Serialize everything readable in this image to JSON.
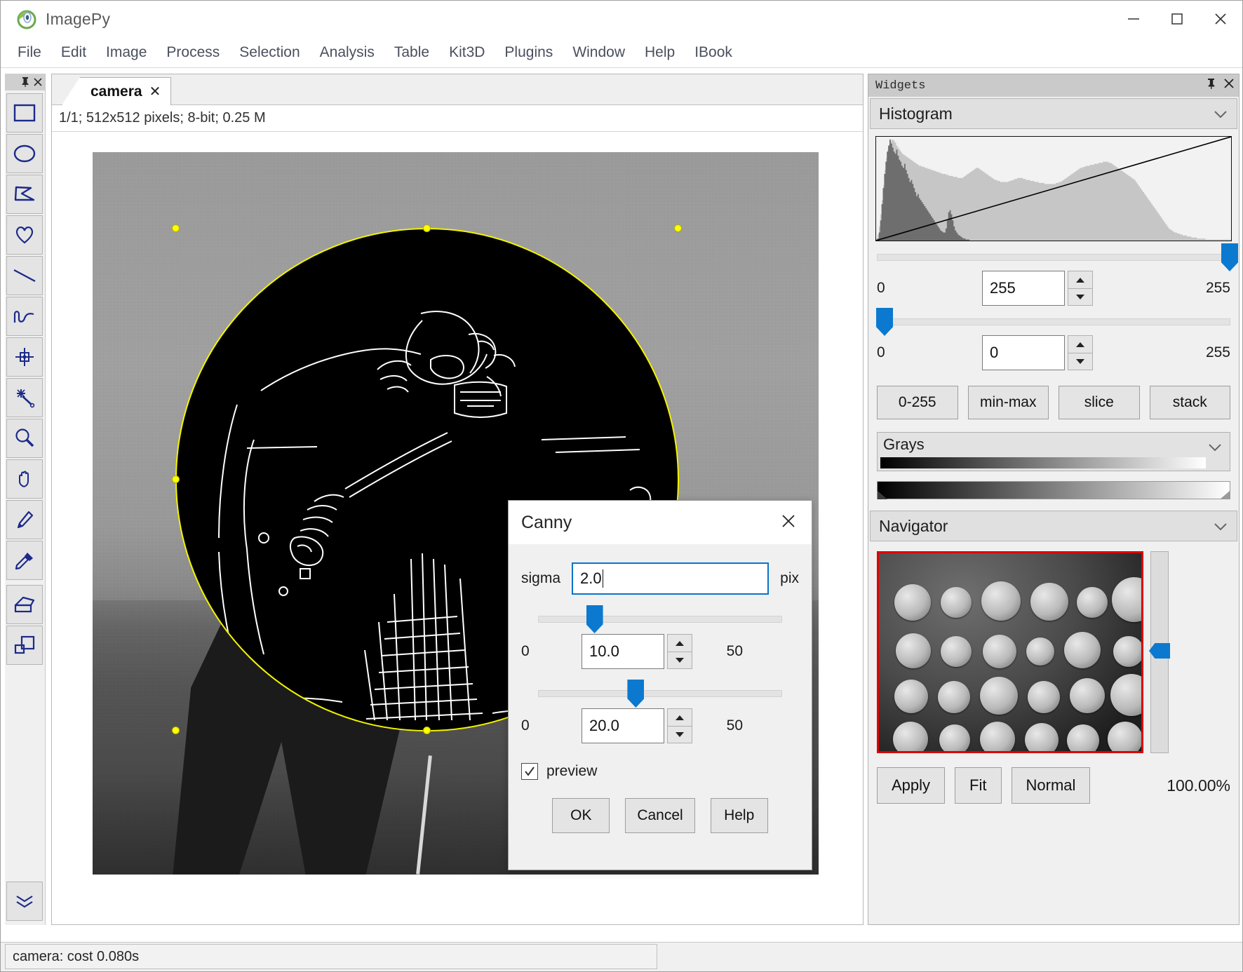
{
  "window": {
    "app_title": "ImagePy",
    "logo_icon": "imagepy-logo-icon",
    "minimize_icon": "minimize-icon",
    "maximize_icon": "maximize-icon",
    "close_icon": "close-icon"
  },
  "menubar": {
    "items": [
      {
        "label": "File"
      },
      {
        "label": "Edit"
      },
      {
        "label": "Image"
      },
      {
        "label": "Process"
      },
      {
        "label": "Selection"
      },
      {
        "label": "Analysis"
      },
      {
        "label": "Table"
      },
      {
        "label": "Kit3D"
      },
      {
        "label": "Plugins"
      },
      {
        "label": "Window"
      },
      {
        "label": "Help"
      },
      {
        "label": "IBook"
      }
    ]
  },
  "toolbar": {
    "pin_icon": "pin-icon",
    "close_icon": "close-icon",
    "tools": [
      {
        "name": "rectangle-tool",
        "icon": "rectangle-icon"
      },
      {
        "name": "ellipse-tool",
        "icon": "ellipse-icon"
      },
      {
        "name": "polygon-tool",
        "icon": "polygon-icon"
      },
      {
        "name": "freehand-tool",
        "icon": "heart-freehand-icon"
      },
      {
        "name": "line-tool",
        "icon": "line-icon"
      },
      {
        "name": "curve-tool",
        "icon": "wave-curve-icon"
      },
      {
        "name": "point-tool",
        "icon": "crosshair-point-icon"
      },
      {
        "name": "magic-wand-tool",
        "icon": "magic-wand-icon"
      },
      {
        "name": "zoom-tool",
        "icon": "magnifier-icon"
      },
      {
        "name": "pan-tool",
        "icon": "hand-icon"
      },
      {
        "name": "pencil-tool",
        "icon": "pencil-icon"
      },
      {
        "name": "dropper-tool",
        "icon": "eyedropper-icon"
      },
      {
        "name": "fill-tool",
        "icon": "paint-bucket-icon"
      },
      {
        "name": "shapes-tool",
        "icon": "overlap-shapes-icon"
      }
    ],
    "bottom_tool": {
      "name": "more-tools",
      "icon": "double-chevron-down-icon"
    }
  },
  "canvas": {
    "tab": {
      "label": "camera",
      "close_icon": "close-icon"
    },
    "info": "1/1;   512x512 pixels; 8-bit; 0.25 M"
  },
  "dialog": {
    "title": "Canny",
    "close_icon": "close-icon",
    "sigma": {
      "label": "sigma",
      "value": "2.0",
      "unit": "pix"
    },
    "low_threshold": {
      "min": "0",
      "value": "10.0",
      "max": "50",
      "slider_percent": 23
    },
    "high_threshold": {
      "min": "0",
      "value": "20.0",
      "max": "50",
      "slider_percent": 40
    },
    "preview": {
      "label": "preview",
      "checked": true,
      "check_icon": "check-icon"
    },
    "buttons": {
      "ok": "OK",
      "cancel": "Cancel",
      "help": "Help"
    }
  },
  "widgets": {
    "panel_title": "Widgets",
    "pin_icon": "pin-icon",
    "close_icon": "close-icon",
    "histogram": {
      "title": "Histogram",
      "chevron_icon": "chevron-down-icon",
      "high": {
        "min": "0",
        "value": "255",
        "max": "255",
        "slider_percent": 100
      },
      "low": {
        "min": "0",
        "value": "0",
        "max": "255",
        "slider_percent": 2
      },
      "buttons": [
        {
          "label": "0-255",
          "name": "range-0-255-button"
        },
        {
          "label": "min-max",
          "name": "range-min-max-button"
        },
        {
          "label": "slice",
          "name": "slice-button"
        },
        {
          "label": "stack",
          "name": "stack-button"
        }
      ],
      "lut": {
        "name": "Grays",
        "chevron_icon": "chevron-down-icon"
      }
    },
    "navigator": {
      "title": "Navigator",
      "chevron_icon": "chevron-down-icon",
      "buttons": {
        "apply": "Apply",
        "fit": "Fit",
        "normal": "Normal"
      },
      "zoom_level": "100.00%"
    }
  },
  "statusbar": {
    "message": "camera: cost 0.080s"
  },
  "colors": {
    "accent_blue": "#0b79cf",
    "tool_blue": "#1c2a8a",
    "roi_yellow": "#f4f400",
    "nav_border_red": "#dd0000"
  },
  "chart_data": {
    "type": "bar",
    "title": "Histogram",
    "xlabel": "",
    "ylabel": "",
    "xlim": [
      0,
      255
    ],
    "ylim": [
      0,
      100
    ],
    "grid": false,
    "legend": "none",
    "series": [
      {
        "name": "image-histogram",
        "color": "#c6c6c6",
        "values": [
          2,
          6,
          14,
          26,
          40,
          55,
          70,
          82,
          90,
          95,
          98,
          100,
          99,
          97,
          94,
          92,
          90,
          88,
          86,
          85,
          84,
          83,
          82,
          81,
          80,
          79,
          78,
          77,
          76,
          75,
          74,
          74,
          73,
          73,
          72,
          72,
          71,
          71,
          70,
          70,
          69,
          69,
          68,
          68,
          67,
          67,
          66,
          66,
          66,
          65,
          65,
          64,
          64,
          64,
          63,
          63,
          63,
          62,
          62,
          62,
          62,
          63,
          64,
          65,
          66,
          67,
          68,
          69,
          70,
          71,
          72,
          72,
          71,
          70,
          69,
          68,
          67,
          66,
          65,
          64,
          63,
          62,
          61,
          60,
          60,
          59,
          59,
          58,
          58,
          58,
          58,
          58,
          58,
          59,
          59,
          60,
          60,
          61,
          61,
          62,
          62,
          62,
          62,
          61,
          61,
          60,
          60,
          60,
          59,
          59,
          59,
          58,
          58,
          58,
          57,
          57,
          57,
          57,
          56,
          56,
          56,
          56,
          56,
          56,
          56,
          56,
          57,
          57,
          58,
          58,
          59,
          60,
          61,
          62,
          63,
          64,
          65,
          66,
          67,
          68,
          69,
          70,
          71,
          72,
          72,
          73,
          73,
          74,
          74,
          74,
          75,
          75,
          75,
          76,
          76,
          76,
          77,
          77,
          77,
          78,
          78,
          78,
          78,
          77,
          77,
          76,
          75,
          74,
          73,
          72,
          71,
          70,
          69,
          68,
          67,
          66,
          65,
          64,
          63,
          62,
          61,
          60,
          58,
          56,
          54,
          52,
          50,
          48,
          46,
          44,
          42,
          40,
          38,
          36,
          34,
          32,
          30,
          28,
          26,
          24,
          22,
          20,
          18,
          16,
          14,
          12,
          11,
          10,
          9,
          8,
          8,
          7,
          7,
          6,
          6,
          5,
          5,
          5,
          4,
          4,
          4,
          3,
          3,
          3,
          3,
          2,
          2,
          2,
          2,
          2,
          2,
          1,
          1,
          1,
          1,
          1,
          1,
          1,
          1,
          1,
          1,
          1,
          1,
          1,
          1,
          1,
          1,
          1,
          1
        ]
      },
      {
        "name": "selected-range-histogram",
        "color": "#6e6e6e",
        "values": [
          0,
          2,
          8,
          20,
          36,
          52,
          66,
          78,
          88,
          94,
          100,
          96,
          92,
          88,
          86,
          90,
          84,
          80,
          78,
          74,
          72,
          76,
          70,
          66,
          62,
          58,
          60,
          56,
          52,
          48,
          44,
          46,
          42,
          40,
          38,
          36,
          34,
          32,
          30,
          28,
          26,
          24,
          22,
          20,
          18,
          16,
          14,
          12,
          10,
          9,
          8,
          8,
          12,
          20,
          28,
          30,
          26,
          20,
          14,
          10,
          8,
          6,
          5,
          4,
          3,
          2,
          2,
          1,
          1,
          1,
          0,
          0,
          0,
          0,
          0,
          0,
          0,
          0,
          0,
          0,
          0,
          0,
          0,
          0,
          0,
          0,
          0,
          0,
          0,
          0,
          0,
          0,
          0,
          0,
          0,
          0,
          0,
          0,
          0,
          0,
          0,
          0,
          0,
          0,
          0,
          0,
          0,
          0,
          0,
          0,
          0,
          0,
          0,
          0,
          0,
          0,
          0,
          0,
          0,
          0,
          0,
          0,
          0,
          0,
          0,
          0,
          0,
          0,
          0,
          0,
          0,
          0,
          0,
          0,
          0,
          0,
          0,
          0,
          0,
          0,
          0,
          0,
          0,
          0,
          0,
          0,
          0,
          0,
          0,
          0,
          0,
          0,
          0,
          0,
          0,
          0,
          0,
          0,
          0,
          0,
          0,
          0,
          0,
          0,
          0,
          0,
          0,
          0,
          0,
          0,
          0,
          0,
          0,
          0,
          0,
          0,
          0,
          0,
          0,
          0,
          0,
          0,
          0,
          0,
          0,
          0,
          0,
          0,
          0,
          0,
          0,
          0,
          0,
          0,
          0,
          0,
          0,
          0,
          0,
          0,
          0,
          0,
          0,
          0,
          0,
          0,
          0,
          0,
          0,
          0,
          0,
          0,
          0,
          0,
          0,
          0,
          0,
          0,
          0,
          0,
          0,
          0,
          0,
          0,
          0,
          0,
          0,
          0,
          0,
          0,
          0,
          0,
          0,
          0,
          0,
          0,
          0,
          0,
          0,
          0,
          0,
          0,
          0,
          0,
          0,
          0,
          0,
          0,
          0,
          0,
          0,
          0,
          0,
          0,
          0,
          0,
          0,
          0,
          0,
          0,
          0,
          0,
          0,
          0,
          0,
          0
        ]
      }
    ],
    "lut_line": {
      "name": "lut-transfer-line",
      "from": [
        0,
        0
      ],
      "to": [
        255,
        100
      ]
    }
  }
}
